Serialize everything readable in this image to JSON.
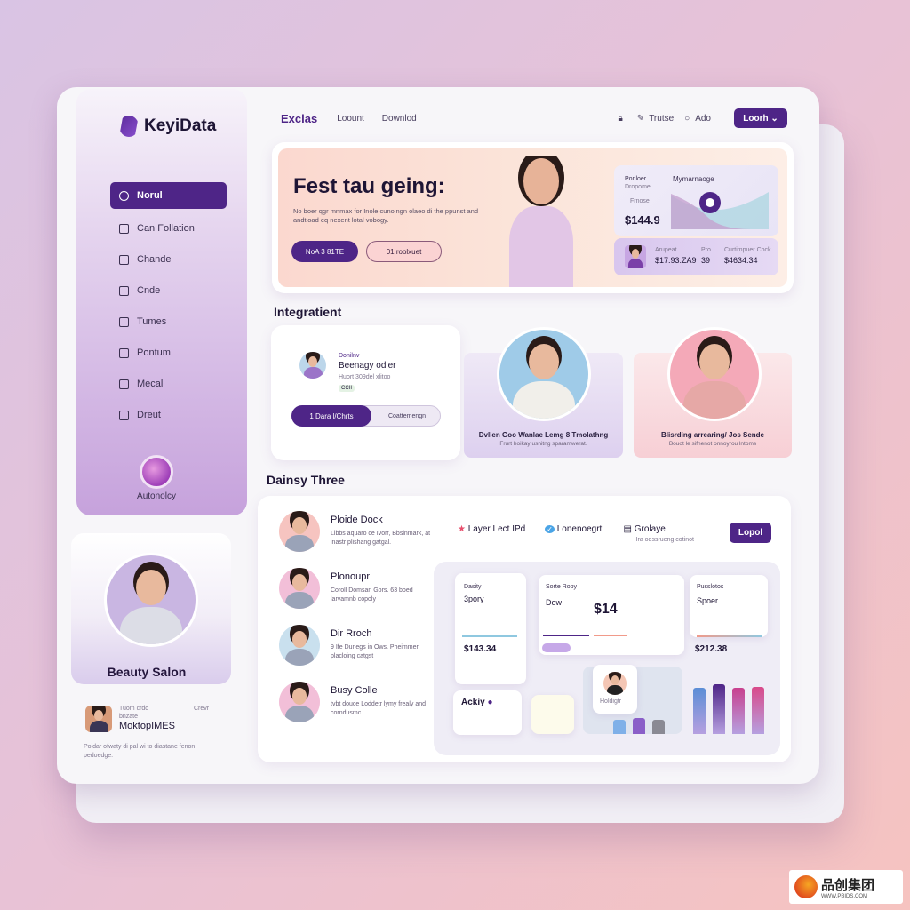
{
  "app": {
    "logo_text": "KeyiData"
  },
  "sidebar": {
    "items": [
      {
        "label": "Norul",
        "icon": "clock-icon",
        "active": true
      },
      {
        "label": "Can Follation",
        "icon": "folder-icon"
      },
      {
        "label": "Chande",
        "icon": "chart-icon"
      },
      {
        "label": "Cnde",
        "icon": "calendar-icon"
      },
      {
        "label": "Tumes",
        "icon": "bag-icon"
      },
      {
        "label": "Pontum",
        "icon": "at-icon"
      },
      {
        "label": "Mecal",
        "icon": "camera-icon"
      },
      {
        "label": "Dreut",
        "icon": "users-icon"
      }
    ],
    "avatar_label": "Autonolcy"
  },
  "profile": {
    "name": "Beauty Salon",
    "meta1": "Tuom crdc",
    "meta2": "bnzate",
    "meta_right": "Crevr",
    "title": "MoktopIMES",
    "desc": "Poidar ofwaty di pal wi to diastane fenon pedoedge."
  },
  "topbar": {
    "brand": "Exclas",
    "links": [
      "Loount",
      "Downlod"
    ],
    "items": [
      "Trutse",
      "Ado"
    ],
    "button": "Loorh"
  },
  "hero": {
    "title": "Fest tau geing:",
    "subtitle": "No boer qgr mnmax for Inole cunolngn olaeo di the ppunst and andtload eq nexent lotal vobogy.",
    "btn_primary": "NoA 3 81TE",
    "btn_secondary": "01 roolxuet",
    "stat": {
      "label1": "Ponloer",
      "label2": "Dropome",
      "chart_title": "Mymarnaoge",
      "value": "$144.9",
      "item1": "Frnose"
    },
    "summary": {
      "label1": "Arupeat",
      "value1": "$17.93.ZA9",
      "label2": "Pro",
      "value2": "39",
      "label3": "Curtimpuer Cock",
      "value3": "$4634.34"
    }
  },
  "integration": {
    "title": "Integratient",
    "profile_card": {
      "small": "Donilnv",
      "name": "Beenagy odler",
      "desc": "Huort 309del xlitoo",
      "badge": "CCII",
      "btn_primary": "1 Dara l/Chrts",
      "btn_secondary": "Coattemengn"
    },
    "cards": [
      {
        "caption": "Dvllen Goo Wanlae Lemg 8 Tmolathng",
        "sub": "Frurt hoikay usnitng sparamwerat."
      },
      {
        "caption": "Blisrding arrearing/ Jos Sende",
        "sub": "Bouot le sifnenot onnoyrou lntoms"
      }
    ]
  },
  "team": {
    "title": "Dainsy Three",
    "people": [
      {
        "name": "Ploide Dock",
        "desc": "Libbs aquaro ce Ivorr, Bbsinmark, at inastr plishang gatgal."
      },
      {
        "name": "Plonoupr",
        "desc": "Coroll Domsan Gors. 63 boed larvamnb copoly"
      },
      {
        "name": "Dir Rroch",
        "desc": "9 Ife Dunegs in Ows. Pheimmer placloing catgst"
      },
      {
        "name": "Busy Colle",
        "desc": "tvbt douce Loddetr lymy frealy and corndusmc."
      }
    ],
    "actions": [
      {
        "label": "Layer Lect IPd",
        "icon": "star-icon"
      },
      {
        "label": "Lonenoegrti",
        "icon": "check-icon"
      },
      {
        "label": "Grolaye",
        "sub": "Ira odssrueng cotinot",
        "icon": "document-icon"
      }
    ],
    "button": "Lopol",
    "widgets": {
      "w1_title": "Dasity",
      "w1_label": "3pory",
      "w1_value": "$143.34",
      "w2_title": "Sorte Ropy",
      "w2_label": "Dow",
      "w2_value": "$14",
      "w3_title": "Pusslotos",
      "w3_label": "Spoer",
      "w3_value": "$212.38",
      "w4_title": "Ackiy",
      "w5_name": "Holdigtr"
    },
    "bar_colors": [
      "#5b8ed6",
      "#4e2587",
      "#c8408e",
      "#d94a8a"
    ]
  },
  "colors": {
    "accent": "#4e2587",
    "background_start": "#d9c4e4",
    "background_end": "#f6c3c0"
  },
  "watermark": {
    "text": "品创集团",
    "url_text": "WWW.PBIDS.COM"
  }
}
